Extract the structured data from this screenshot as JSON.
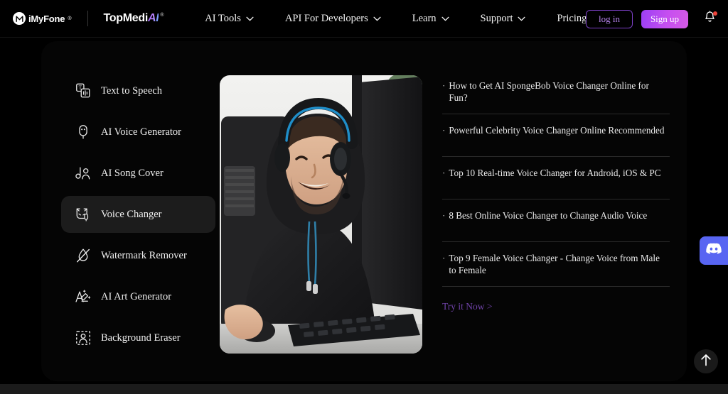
{
  "header": {
    "brand_primary": "iMyFone",
    "brand_primary_reg": "®",
    "brand_secondary_prefix": "TopMedi",
    "brand_secondary_accent": "AI",
    "brand_secondary_reg": "®",
    "nav": [
      {
        "label": "AI Tools",
        "has_caret": true,
        "icon": "chevron-down-icon"
      },
      {
        "label": "API For Developers",
        "has_caret": true,
        "icon": "chevron-down-icon"
      },
      {
        "label": "Learn",
        "has_caret": true,
        "icon": "chevron-down-icon"
      },
      {
        "label": "Support",
        "has_caret": true,
        "icon": "chevron-down-icon"
      },
      {
        "label": "Pricing",
        "has_caret": false,
        "icon": ""
      }
    ],
    "login_label": "log in",
    "signup_label": "Sign up",
    "bell_icon": "notification-bell-icon",
    "bell_has_badge": true
  },
  "sidebar": {
    "items": [
      {
        "label": "Text to Speech",
        "icon": "text-to-speech-icon",
        "active": false
      },
      {
        "label": "AI Voice Generator",
        "icon": "microphone-icon",
        "active": false
      },
      {
        "label": "AI Song Cover",
        "icon": "music-person-icon",
        "active": false
      },
      {
        "label": "Voice Changer",
        "icon": "cat-voice-icon",
        "active": true
      },
      {
        "label": "Watermark Remover",
        "icon": "droplet-slash-icon",
        "active": false
      },
      {
        "label": "AI Art Generator",
        "icon": "art-pen-icon",
        "active": false
      },
      {
        "label": "Background Eraser",
        "icon": "person-dashed-box-icon",
        "active": false
      }
    ]
  },
  "hero": {
    "alt": "smiling man wearing gaming headset at a desktop computer",
    "icon": "hero-photo"
  },
  "articles": {
    "items": [
      {
        "bullet": "·",
        "title": "How to Get AI SpongeBob Voice Changer Online for Fun?"
      },
      {
        "bullet": "·",
        "title": "Powerful Celebrity Voice Changer Online Recommended"
      },
      {
        "bullet": "·",
        "title": "Top 10 Real-time Voice Changer for Android, iOS & PC"
      },
      {
        "bullet": "·",
        "title": "8 Best Online Voice Changer to Change Audio Voice"
      },
      {
        "bullet": "·",
        "title": "Top 9 Female Voice Changer - Change Voice from Male to Female"
      }
    ],
    "cta_label": "Try it Now >"
  },
  "floating": {
    "discord_icon": "discord-icon",
    "scroll_top_icon": "arrow-up-icon"
  },
  "colors": {
    "accent_purple": "#9b3ff5",
    "accent_magenta": "#d65ae6",
    "login_border": "#7b3fc4",
    "login_text": "#b984f0",
    "link_purple": "#6f42a8",
    "discord_blue": "#5865F2",
    "badge_red": "#f0443a",
    "panel_bg": "#050505",
    "active_item_bg": "#1c1c1c",
    "page_bg": "#000000"
  }
}
